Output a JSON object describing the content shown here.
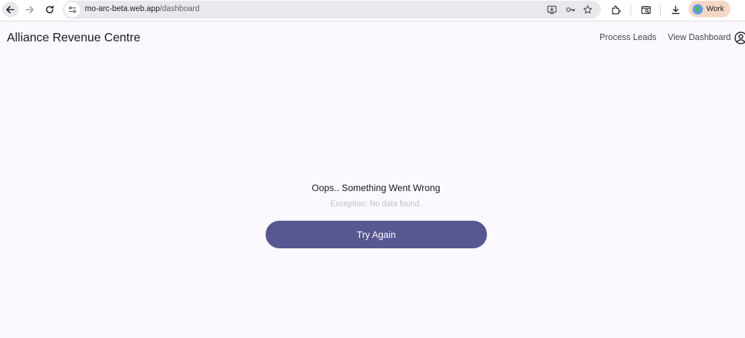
{
  "browser": {
    "url_host": "mo-arc-beta.web.app",
    "url_path": "/dashboard",
    "profile_label": "Work",
    "icons": [
      "back-arrow-icon",
      "forward-arrow-icon",
      "reload-icon",
      "site-info-icon",
      "install-app-icon",
      "password-key-icon",
      "bookmark-star-icon",
      "extensions-icon",
      "search-tab-icon",
      "download-icon",
      "globe-avatar-icon"
    ]
  },
  "app": {
    "title": "Alliance Revenue Centre",
    "nav": {
      "process_leads": "Process Leads",
      "view_dashboard": "View Dashboard"
    }
  },
  "error": {
    "title": "Oops.. Something Went Wrong",
    "message": "Exception: No data found.",
    "retry_label": "Try Again"
  },
  "colors": {
    "primary": "#575891",
    "background": "#fbf8fe",
    "profile_chip": "#f5d7c8"
  }
}
